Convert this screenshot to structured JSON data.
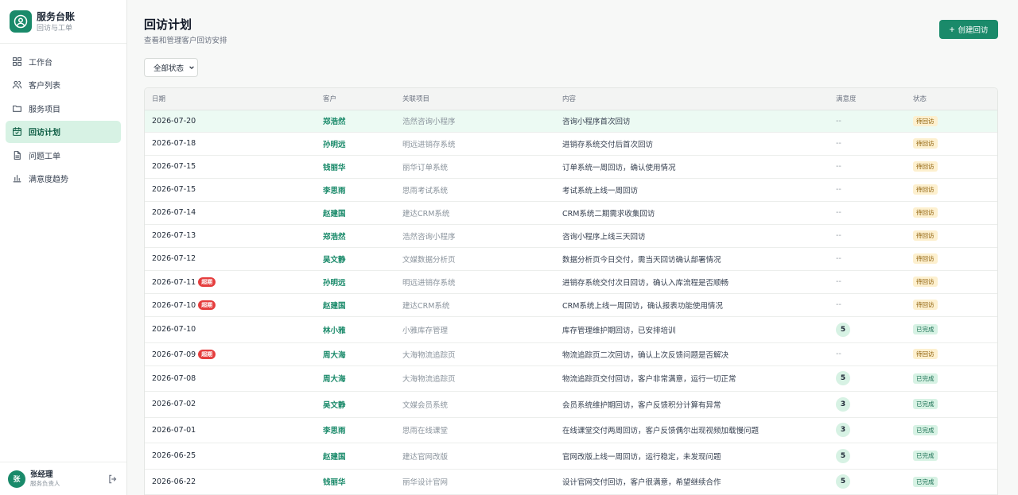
{
  "brand": {
    "title": "服务台账",
    "subtitle": "回访与工单"
  },
  "nav": [
    {
      "label": "工作台",
      "icon": "grid-icon",
      "active": false
    },
    {
      "label": "客户列表",
      "icon": "users-icon",
      "active": false
    },
    {
      "label": "服务项目",
      "icon": "folder-icon",
      "active": false
    },
    {
      "label": "回访计划",
      "icon": "calendar-icon",
      "active": true
    },
    {
      "label": "问题工单",
      "icon": "document-icon",
      "active": false
    },
    {
      "label": "满意度趋势",
      "icon": "bar-chart-icon",
      "active": false
    }
  ],
  "user": {
    "avatar": "张",
    "name": "张经理",
    "role": "服务负责人"
  },
  "page": {
    "title": "回访计划",
    "subtitle": "查看和管理客户回访安排",
    "create_label": "创建回访"
  },
  "filter": {
    "value": "全部状态"
  },
  "table": {
    "headers": [
      "日期",
      "客户",
      "关联项目",
      "内容",
      "满意度",
      "状态"
    ],
    "rows": [
      {
        "date": "2026-07-20",
        "overdue": "",
        "customer": "郑浩然",
        "project": "浩然咨询小程序",
        "content": "咨询小程序首次回访",
        "score": "--",
        "status": "待回访",
        "status_type": "pending"
      },
      {
        "date": "2026-07-18",
        "overdue": "",
        "customer": "孙明远",
        "project": "明远进销存系统",
        "content": "进销存系统交付后首次回访",
        "score": "--",
        "status": "待回访",
        "status_type": "pending"
      },
      {
        "date": "2026-07-15",
        "overdue": "",
        "customer": "钱丽华",
        "project": "丽华订单系统",
        "content": "订单系统一周回访，确认使用情况",
        "score": "--",
        "status": "待回访",
        "status_type": "pending"
      },
      {
        "date": "2026-07-15",
        "overdue": "",
        "customer": "李思雨",
        "project": "思雨考试系统",
        "content": "考试系统上线一周回访",
        "score": "--",
        "status": "待回访",
        "status_type": "pending"
      },
      {
        "date": "2026-07-14",
        "overdue": "",
        "customer": "赵建国",
        "project": "建达CRM系统",
        "content": "CRM系统二期需求收集回访",
        "score": "--",
        "status": "待回访",
        "status_type": "pending"
      },
      {
        "date": "2026-07-13",
        "overdue": "",
        "customer": "郑浩然",
        "project": "浩然咨询小程序",
        "content": "咨询小程序上线三天回访",
        "score": "--",
        "status": "待回访",
        "status_type": "pending"
      },
      {
        "date": "2026-07-12",
        "overdue": "",
        "customer": "吴文静",
        "project": "文媒数据分析页",
        "content": "数据分析页今日交付，需当天回访确认部署情况",
        "score": "--",
        "status": "待回访",
        "status_type": "pending"
      },
      {
        "date": "2026-07-11",
        "overdue": "超期",
        "customer": "孙明远",
        "project": "明远进销存系统",
        "content": "进销存系统交付次日回访，确认入库流程是否顺畅",
        "score": "--",
        "status": "待回访",
        "status_type": "pending"
      },
      {
        "date": "2026-07-10",
        "overdue": "超期",
        "customer": "赵建国",
        "project": "建达CRM系统",
        "content": "CRM系统上线一周回访，确认报表功能使用情况",
        "score": "--",
        "status": "待回访",
        "status_type": "pending"
      },
      {
        "date": "2026-07-10",
        "overdue": "",
        "customer": "林小雅",
        "project": "小雅库存管理",
        "content": "库存管理维护期回访，已安排培训",
        "score": "5",
        "status": "已完成",
        "status_type": "done"
      },
      {
        "date": "2026-07-09",
        "overdue": "超期",
        "customer": "周大海",
        "project": "大海物流追踪页",
        "content": "物流追踪页二次回访，确认上次反馈问题是否解决",
        "score": "--",
        "status": "待回访",
        "status_type": "pending"
      },
      {
        "date": "2026-07-08",
        "overdue": "",
        "customer": "周大海",
        "project": "大海物流追踪页",
        "content": "物流追踪页交付回访，客户非常满意，运行一切正常",
        "score": "5",
        "status": "已完成",
        "status_type": "done"
      },
      {
        "date": "2026-07-02",
        "overdue": "",
        "customer": "吴文静",
        "project": "文媒会员系统",
        "content": "会员系统维护期回访，客户反馈积分计算有异常",
        "score": "3",
        "status": "已完成",
        "status_type": "done"
      },
      {
        "date": "2026-07-01",
        "overdue": "",
        "customer": "李思雨",
        "project": "思雨在线课堂",
        "content": "在线课堂交付两周回访，客户反馈偶尔出现视频加载慢问题",
        "score": "3",
        "status": "已完成",
        "status_type": "done"
      },
      {
        "date": "2026-06-25",
        "overdue": "",
        "customer": "赵建国",
        "project": "建达官网改版",
        "content": "官网改版上线一周回访，运行稳定，未发现问题",
        "score": "5",
        "status": "已完成",
        "status_type": "done"
      },
      {
        "date": "2026-06-22",
        "overdue": "",
        "customer": "钱丽华",
        "project": "丽华设计官网",
        "content": "设计官网交付回访，客户很满意，希望继续合作",
        "score": "5",
        "status": "已完成",
        "status_type": "done"
      }
    ]
  }
}
